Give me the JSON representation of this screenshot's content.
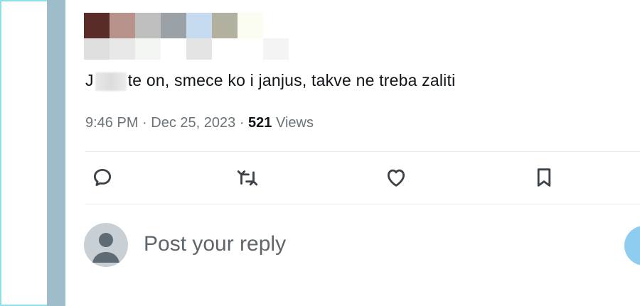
{
  "tweet": {
    "text_prefix": "J",
    "text_rest": "te on, smece ko i janjus, takve ne treba zaliti",
    "time": "9:46 PM",
    "date": "Dec 25, 2023",
    "views_count": "521",
    "views_label": "Views"
  },
  "actions": {
    "reply_icon": "speech-bubble",
    "retweet_icon": "repost-arrows",
    "like_icon": "heart",
    "bookmark_icon": "bookmark"
  },
  "reply_box": {
    "placeholder": "Post your reply"
  },
  "colors": {
    "accent_border": "#8fe0e6",
    "left_bar": "#9fbccb",
    "muted_text": "#6b7378",
    "main_text": "#0f1419",
    "reply_button": "#8ecdf0"
  }
}
